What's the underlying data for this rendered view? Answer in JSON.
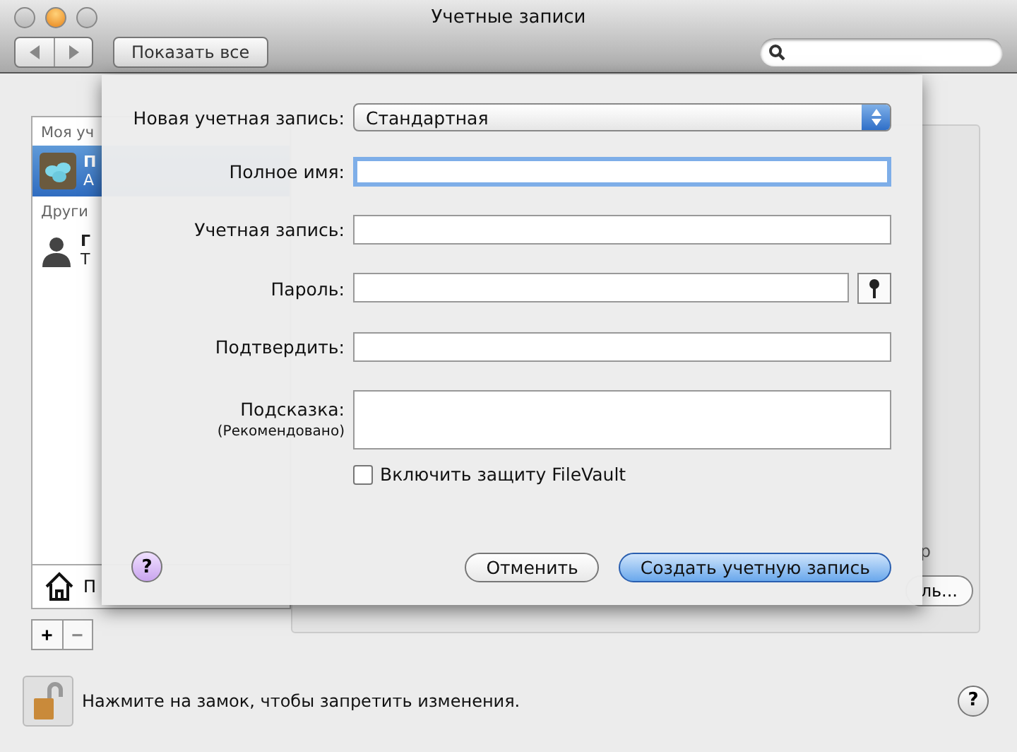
{
  "window": {
    "title": "Учетные записи"
  },
  "toolbar": {
    "show_all": "Показать все"
  },
  "sidebar": {
    "sections": [
      {
        "header": "Моя уч",
        "items": [
          {
            "kind": "user",
            "line1": "П",
            "line2": "А",
            "selected": true
          }
        ]
      },
      {
        "header": "Други",
        "items": [
          {
            "kind": "guest",
            "line1": "Г",
            "line2": "Т",
            "selected": false
          }
        ]
      }
    ],
    "login_options": "П",
    "add": "+",
    "remove": "−"
  },
  "background": {
    "button_fragment": "ль...",
    "text_fragment": "р"
  },
  "sheet": {
    "account_type": {
      "label": "Новая учетная запись:",
      "value": "Стандартная"
    },
    "fields": [
      {
        "kind": "text",
        "label": "Полное имя:",
        "focused": true
      },
      {
        "kind": "text",
        "label": "Учетная запись:",
        "focused": false
      },
      {
        "kind": "password",
        "label": "Пароль:",
        "focused": false
      },
      {
        "kind": "text",
        "label": "Подтвердить:",
        "focused": false
      },
      {
        "kind": "area",
        "label": "Подсказка:",
        "sublabel": "(Рекомендовано)",
        "focused": false
      }
    ],
    "filevault": {
      "label": "Включить защиту FileVault",
      "checked": false
    },
    "help": "?",
    "buttons": [
      {
        "label": "Отменить",
        "kind": "default"
      },
      {
        "label": "Создать учетную запись",
        "kind": "primary"
      }
    ]
  },
  "footer": {
    "lock_text": "Нажмите на замок, чтобы запретить изменения.",
    "help": "?"
  }
}
